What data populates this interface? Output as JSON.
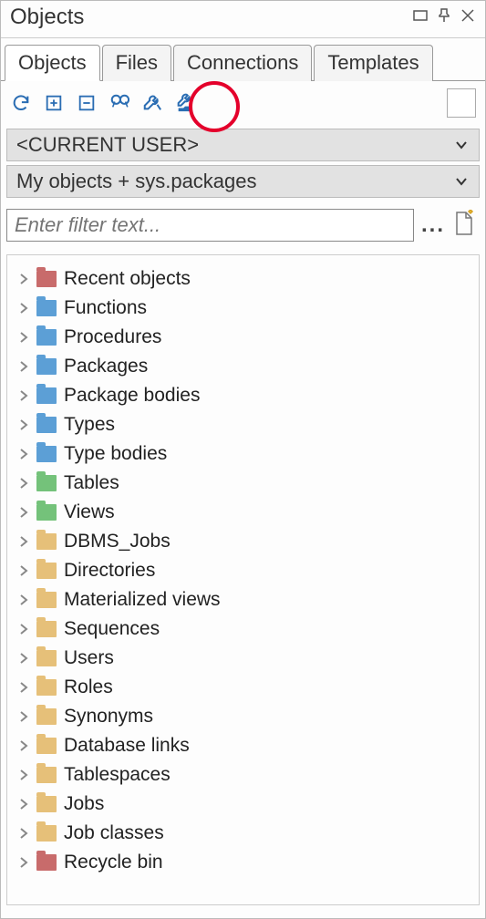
{
  "window": {
    "title": "Objects"
  },
  "tabs": [
    {
      "label": "Objects",
      "active": true
    },
    {
      "label": "Files",
      "active": false
    },
    {
      "label": "Connections",
      "active": false
    },
    {
      "label": "Templates",
      "active": false
    }
  ],
  "toolbar_icons": [
    "refresh",
    "expand",
    "collapse",
    "find",
    "wrench-arrow",
    "wrench-folder"
  ],
  "user_selector": "<CURRENT USER>",
  "scope_selector": "My objects + sys.packages",
  "filter": {
    "placeholder": "Enter filter text..."
  },
  "tree": [
    {
      "label": "Recent objects",
      "color": "red"
    },
    {
      "label": "Functions",
      "color": "blue"
    },
    {
      "label": "Procedures",
      "color": "blue"
    },
    {
      "label": "Packages",
      "color": "blue"
    },
    {
      "label": "Package bodies",
      "color": "blue"
    },
    {
      "label": "Types",
      "color": "blue"
    },
    {
      "label": "Type bodies",
      "color": "blue"
    },
    {
      "label": "Tables",
      "color": "green"
    },
    {
      "label": "Views",
      "color": "green"
    },
    {
      "label": "DBMS_Jobs",
      "color": "tan"
    },
    {
      "label": "Directories",
      "color": "tan"
    },
    {
      "label": "Materialized views",
      "color": "tan"
    },
    {
      "label": "Sequences",
      "color": "tan"
    },
    {
      "label": "Users",
      "color": "tan"
    },
    {
      "label": "Roles",
      "color": "tan"
    },
    {
      "label": "Synonyms",
      "color": "tan"
    },
    {
      "label": "Database links",
      "color": "tan"
    },
    {
      "label": "Tablespaces",
      "color": "tan"
    },
    {
      "label": "Jobs",
      "color": "tan"
    },
    {
      "label": "Job classes",
      "color": "tan"
    },
    {
      "label": "Recycle bin",
      "color": "red"
    }
  ]
}
